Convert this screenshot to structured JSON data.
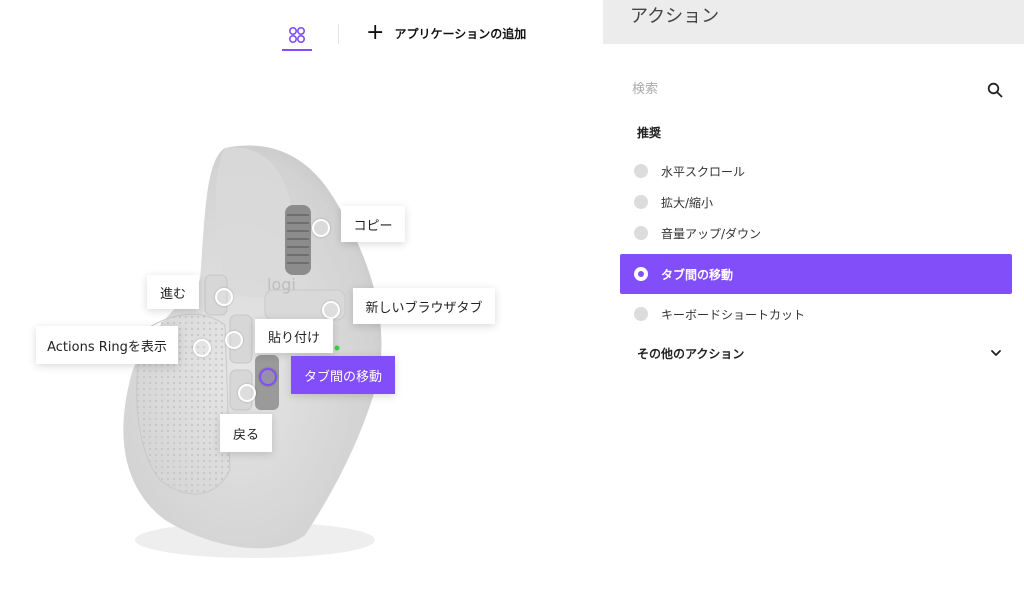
{
  "toolbar": {
    "add_app_label": "アプリケーションの追加",
    "plus_glyph": "+"
  },
  "callouts": {
    "copy": "コピー",
    "forward": "進む",
    "new_tab": "新しいブラウザタブ",
    "actions_ring": "Actions Ringを表示",
    "paste": "貼り付け",
    "tab_switch": "タブ間の移動",
    "back": "戻る"
  },
  "mouse": {
    "logo_text": "logi"
  },
  "panel": {
    "title": "アクション",
    "search_placeholder": "検索",
    "recommended_title": "推奨",
    "actions": [
      "水平スクロール",
      "拡大/縮小",
      "音量アップ/ダウン",
      "タブ間の移動",
      "キーボードショートカット"
    ],
    "selected_index": 3,
    "more_actions_label": "その他のアクション"
  },
  "colors": {
    "accent": "#814efa",
    "header_bg": "#ececec",
    "radio_inactive": "#dcdcdc"
  },
  "icons": [
    "apps-grid-icon",
    "plus-icon",
    "search-icon",
    "chevron-down-icon"
  ]
}
